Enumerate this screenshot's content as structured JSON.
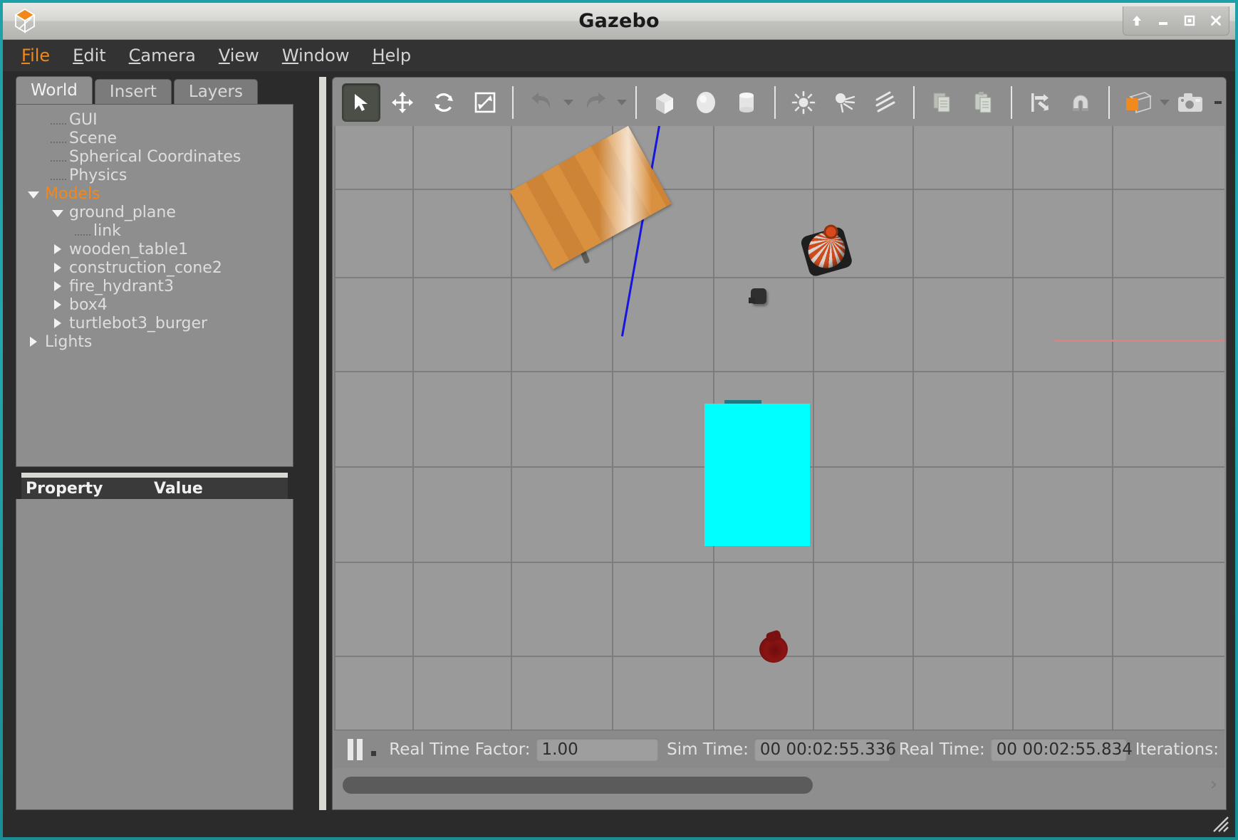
{
  "window": {
    "title": "Gazebo",
    "logo_icon": "gazebo-cube-logo",
    "controls": [
      {
        "name": "shade-button",
        "icon": "up-arrow-icon",
        "glyph": "⬆"
      },
      {
        "name": "minimize-button",
        "icon": "minimize-icon",
        "glyph": "—"
      },
      {
        "name": "maximize-button",
        "icon": "maximize-icon",
        "glyph": "□"
      },
      {
        "name": "close-button",
        "icon": "close-icon",
        "glyph": "✕"
      }
    ]
  },
  "menubar": {
    "items": [
      {
        "label": "File",
        "mnemonic": "F",
        "rest": "ile",
        "active": true
      },
      {
        "label": "Edit",
        "mnemonic": "E",
        "rest": "dit",
        "active": false
      },
      {
        "label": "Camera",
        "mnemonic": "C",
        "rest": "amera",
        "active": false
      },
      {
        "label": "View",
        "mnemonic": "V",
        "rest": "iew",
        "active": false
      },
      {
        "label": "Window",
        "mnemonic": "W",
        "rest": "indow",
        "active": false
      },
      {
        "label": "Help",
        "mnemonic": "H",
        "rest": "elp",
        "active": false
      }
    ]
  },
  "left_panel": {
    "tabs": [
      {
        "label": "World",
        "active": true
      },
      {
        "label": "Insert",
        "active": false
      },
      {
        "label": "Layers",
        "active": false
      }
    ],
    "tree": [
      {
        "label": "GUI",
        "indent": 1,
        "toggle": "leaf",
        "accent": false
      },
      {
        "label": "Scene",
        "indent": 1,
        "toggle": "leaf",
        "accent": false
      },
      {
        "label": "Spherical Coordinates",
        "indent": 1,
        "toggle": "leaf",
        "accent": false
      },
      {
        "label": "Physics",
        "indent": 1,
        "toggle": "leaf",
        "accent": false
      },
      {
        "label": "Models",
        "indent": 0,
        "toggle": "expanded",
        "accent": true
      },
      {
        "label": "ground_plane",
        "indent": 1,
        "toggle": "expanded",
        "accent": false
      },
      {
        "label": "link",
        "indent": 2,
        "toggle": "leaf",
        "accent": false
      },
      {
        "label": "wooden_table1",
        "indent": 1,
        "toggle": "collapsed",
        "accent": false
      },
      {
        "label": "construction_cone2",
        "indent": 1,
        "toggle": "collapsed",
        "accent": false
      },
      {
        "label": "fire_hydrant3",
        "indent": 1,
        "toggle": "collapsed",
        "accent": false
      },
      {
        "label": "box4",
        "indent": 1,
        "toggle": "collapsed",
        "accent": false
      },
      {
        "label": "turtlebot3_burger",
        "indent": 1,
        "toggle": "collapsed",
        "accent": false
      },
      {
        "label": "Lights",
        "indent": 0,
        "toggle": "collapsed",
        "accent": false
      }
    ],
    "property_table": {
      "columns": [
        "Property",
        "Value"
      ],
      "rows": []
    }
  },
  "toolbar": {
    "buttons": [
      {
        "name": "select-mode-button",
        "icon": "cursor-arrow-icon",
        "pressed": true
      },
      {
        "name": "translate-mode-button",
        "icon": "move-arrows-icon",
        "pressed": false
      },
      {
        "name": "rotate-mode-button",
        "icon": "rotate-arrows-icon",
        "pressed": false
      },
      {
        "name": "scale-mode-button",
        "icon": "scale-arrows-icon",
        "pressed": false
      },
      {
        "name": "undo-button",
        "icon": "undo-arrow-icon",
        "pressed": false
      },
      {
        "name": "redo-button",
        "icon": "redo-arrow-icon",
        "pressed": false
      },
      {
        "name": "insert-box-button",
        "icon": "box-shape-icon",
        "pressed": false
      },
      {
        "name": "insert-sphere-button",
        "icon": "sphere-shape-icon",
        "pressed": false
      },
      {
        "name": "insert-cylinder-button",
        "icon": "cylinder-shape-icon",
        "pressed": false
      },
      {
        "name": "insert-point-light-button",
        "icon": "point-light-icon",
        "pressed": false
      },
      {
        "name": "insert-spot-light-button",
        "icon": "spot-light-icon",
        "pressed": false
      },
      {
        "name": "insert-directional-light-button",
        "icon": "directional-light-icon",
        "pressed": false
      },
      {
        "name": "copy-button",
        "icon": "copy-icon",
        "pressed": false
      },
      {
        "name": "paste-button",
        "icon": "paste-icon",
        "pressed": false
      },
      {
        "name": "align-button",
        "icon": "align-icon",
        "pressed": false
      },
      {
        "name": "snap-button",
        "icon": "magnet-icon",
        "pressed": false
      },
      {
        "name": "view-mode-button",
        "icon": "view-cube-icon",
        "pressed": false
      },
      {
        "name": "screenshot-button",
        "icon": "camera-icon",
        "pressed": false
      }
    ]
  },
  "scene": {
    "objects": [
      {
        "name": "wooden-table",
        "label": "wooden_table1",
        "color": "#d18b38"
      },
      {
        "name": "construction-cone",
        "label": "construction_cone2",
        "color": "#cf4a1c"
      },
      {
        "name": "turtlebot",
        "label": "turtlebot3_burger",
        "color": "#2f2f2f"
      },
      {
        "name": "cyan-box",
        "label": "box4",
        "color": "#00ffff"
      },
      {
        "name": "fire-hydrant",
        "label": "fire_hydrant3",
        "color": "#8b1414"
      }
    ],
    "axes": [
      {
        "name": "x-axis-line",
        "color": "#e08080"
      },
      {
        "name": "z-axis-line",
        "color": "#1616e0"
      }
    ],
    "ground_color": "#9a9a9a",
    "grid_color": "#7d7d7d"
  },
  "statusbar": {
    "pause_icon": "pause-icon",
    "step_icon": "step-icon",
    "real_time_factor_label": "Real Time Factor:",
    "real_time_factor_value": "1.00",
    "sim_time_label": "Sim Time:",
    "sim_time_value": "00 00:02:55.336",
    "real_time_label": "Real Time:",
    "real_time_value": "00 00:02:55.834",
    "iterations_label": "Iterations:"
  }
}
